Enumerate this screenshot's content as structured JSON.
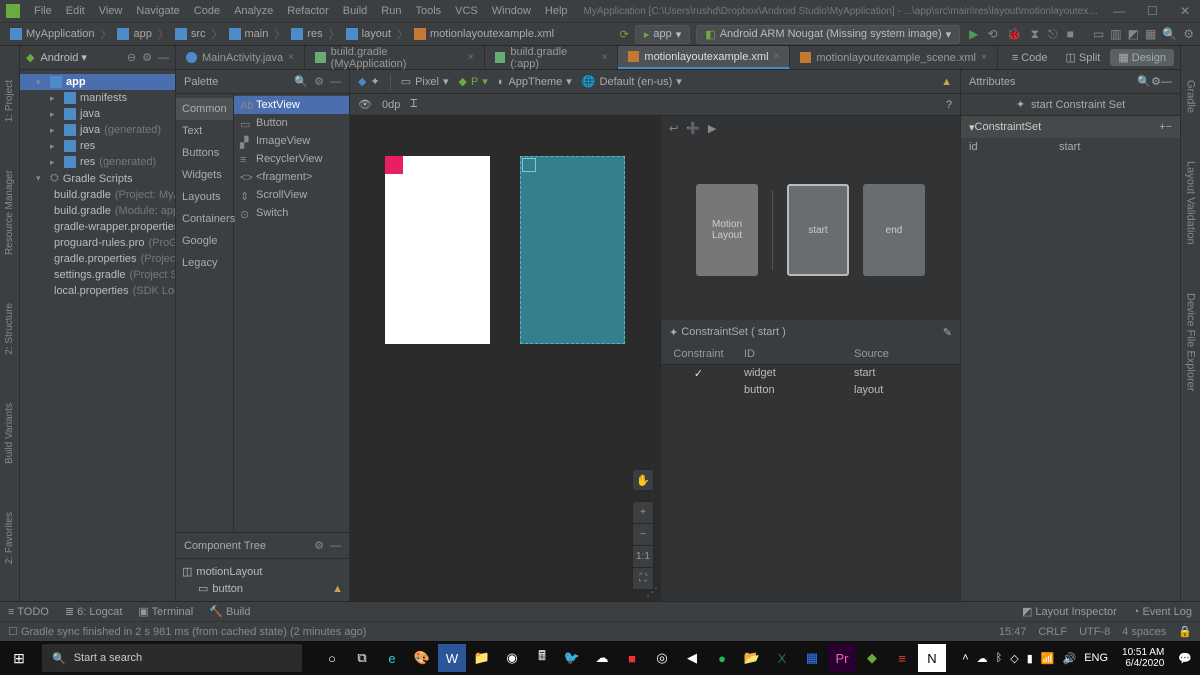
{
  "menus": [
    "File",
    "Edit",
    "View",
    "Navigate",
    "Code",
    "Analyze",
    "Refactor",
    "Build",
    "Run",
    "Tools",
    "VCS",
    "Window",
    "Help"
  ],
  "windowTitle": "MyApplication [C:\\Users\\rushd\\Dropbox\\Android Studio\\MyApplication] - ...\\app\\src\\main\\res\\layout\\motionlayoutexample.xml [app]",
  "crumbs": [
    "MyApplication",
    "app",
    "src",
    "main",
    "res",
    "layout",
    "motionlayoutexample.xml"
  ],
  "runConfig": "app",
  "deviceTarget": "Android ARM Nougat (Missing system image)",
  "leftStrip": [
    "1: Project",
    "Resource Manager",
    "2: Structure",
    "Build Variants",
    "2: Favorites"
  ],
  "rightStrip": [
    "Gradle",
    "Layout Validation",
    "Device File Explorer"
  ],
  "projectView": "Android",
  "tree": {
    "root": "app",
    "items": [
      {
        "label": "manifests",
        "type": "folder",
        "indent": 2
      },
      {
        "label": "java",
        "type": "folder",
        "indent": 2
      },
      {
        "label": "java",
        "suffix": "(generated)",
        "type": "folder",
        "indent": 2
      },
      {
        "label": "res",
        "type": "folder",
        "indent": 2
      },
      {
        "label": "res",
        "suffix": "(generated)",
        "type": "folder",
        "indent": 2
      }
    ],
    "gradle": "Gradle Scripts",
    "gradleItems": [
      {
        "label": "build.gradle",
        "suffix": "(Project: MyA"
      },
      {
        "label": "build.gradle",
        "suffix": "(Module: app"
      },
      {
        "label": "gradle-wrapper.properties",
        "suffix": ""
      },
      {
        "label": "proguard-rules.pro",
        "suffix": "(ProGu"
      },
      {
        "label": "gradle.properties",
        "suffix": "(Project"
      },
      {
        "label": "settings.gradle",
        "suffix": "(Project Se"
      },
      {
        "label": "local.properties",
        "suffix": "(SDK Loc"
      }
    ]
  },
  "tabs": [
    {
      "label": "MainActivity.java",
      "type": "jav"
    },
    {
      "label": "build.gradle (MyApplication)",
      "type": "grd"
    },
    {
      "label": "build.gradle (:app)",
      "type": "grd"
    },
    {
      "label": "motionlayoutexample.xml",
      "type": "xml",
      "active": true
    },
    {
      "label": "motionlayoutexample_scene.xml",
      "type": "xml"
    }
  ],
  "viewModes": [
    "Code",
    "Split",
    "Design"
  ],
  "palette": {
    "title": "Palette",
    "cats": [
      "Common",
      "Text",
      "Buttons",
      "Widgets",
      "Layouts",
      "Containers",
      "Google",
      "Legacy"
    ],
    "items": [
      "TextView",
      "Button",
      "ImageView",
      "RecyclerView",
      "<fragment>",
      "ScrollView",
      "Switch"
    ]
  },
  "designToolbar": {
    "device": "Pixel",
    "api": "P",
    "theme": "AppTheme",
    "locale": "Default (en-us)",
    "zoom": "0dp"
  },
  "componentTree": {
    "title": "Component Tree",
    "root": "motionLayout",
    "child": "button"
  },
  "motion": {
    "boxes": [
      "Motion Layout",
      "start",
      "end"
    ],
    "constraintSetLabel": "ConstraintSet ( start )",
    "headers": [
      "Constraint",
      "ID",
      "Source"
    ],
    "rows": [
      {
        "c1": "✓",
        "c2": "widget",
        "c3": "start"
      },
      {
        "c1": "",
        "c2": "button",
        "c3": "layout"
      }
    ]
  },
  "attributes": {
    "title": "Attributes",
    "sub": "start Constraint Set",
    "section": "ConstraintSet",
    "rows": [
      {
        "k": "id",
        "v": "start"
      }
    ]
  },
  "bottom": {
    "items": [
      "TODO",
      "6: Logcat",
      "Terminal",
      "Build"
    ],
    "right": [
      "Layout Inspector",
      "Event Log"
    ]
  },
  "status": {
    "msg": "Gradle sync finished in 2 s 981 ms (from cached state) (2 minutes ago)",
    "time": "15:47",
    "enc": "CRLF",
    "enc2": "UTF-8",
    "ind": "4 spaces"
  },
  "taskbar": {
    "search": "Start a search",
    "time": "10:51 AM",
    "date": "6/4/2020",
    "lang": "ENG"
  }
}
